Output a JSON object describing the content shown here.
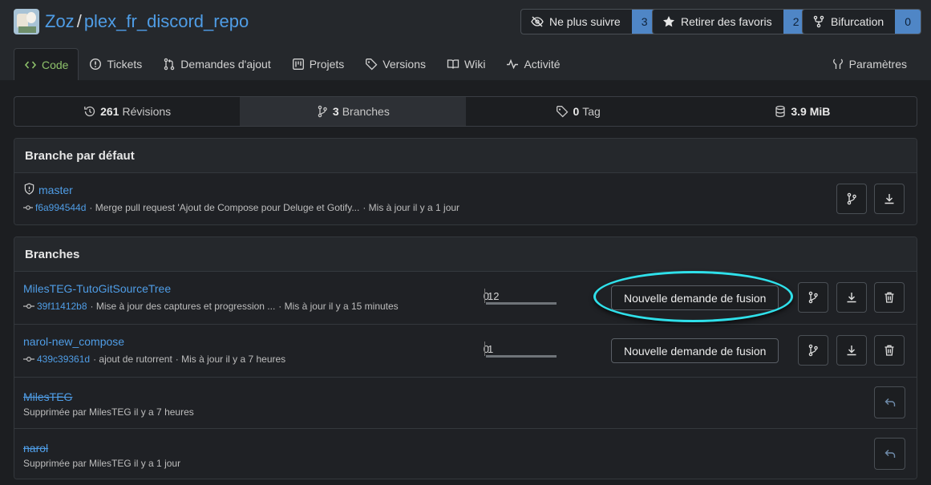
{
  "repo": {
    "owner": "Zoz",
    "separator": "/",
    "name": "plex_fr_discord_repo"
  },
  "header_buttons": {
    "watch": {
      "label": "Ne plus suivre",
      "count": "3"
    },
    "star": {
      "label": "Retirer des favoris",
      "count": "2"
    },
    "fork": {
      "label": "Bifurcation",
      "count": "0"
    }
  },
  "tabs": [
    {
      "label": "Code",
      "icon": "code-icon"
    },
    {
      "label": "Tickets",
      "icon": "issue-icon"
    },
    {
      "label": "Demandes d'ajout",
      "icon": "pull-request-icon"
    },
    {
      "label": "Projets",
      "icon": "project-icon"
    },
    {
      "label": "Versions",
      "icon": "tag-icon"
    },
    {
      "label": "Wiki",
      "icon": "book-icon"
    },
    {
      "label": "Activité",
      "icon": "pulse-icon"
    }
  ],
  "settings_tab": {
    "label": "Paramètres",
    "icon": "tools-icon"
  },
  "stats": {
    "commits": {
      "count": "261",
      "label": "Révisions"
    },
    "branches": {
      "count": "3",
      "label": "Branches"
    },
    "tags": {
      "count": "0",
      "label": "Tag"
    },
    "size": {
      "count": "3.9 MiB",
      "label": ""
    }
  },
  "default_branch": {
    "heading": "Branche par défaut",
    "name": "master",
    "sha": "f6a994544d",
    "message": "· Merge pull request 'Ajout de Compose pour Deluge et Gotify...",
    "updated": "· Mis à jour il y a 1 jour"
  },
  "branches": {
    "heading": "Branches",
    "pr_button_label": "Nouvelle demande de fusion",
    "active": [
      {
        "name": "MilesTEG-TutoGitSourceTree",
        "sha": "39f11412b8",
        "message": "· Mise à jour des captures et progression ...",
        "updated": "· Mis à jour il y a 15 minutes",
        "behind": "0",
        "ahead": "12"
      },
      {
        "name": "narol-new_compose",
        "sha": "439c39361d",
        "message": "· ajout de rutorrent",
        "updated": "· Mis à jour il y a 7 heures",
        "behind": "0",
        "ahead": "1"
      }
    ],
    "deleted": [
      {
        "name": "MilesTEG",
        "info": "Supprimée par MilesTEG il y a 7 heures"
      },
      {
        "name": "narol",
        "info": "Supprimée par MilesTEG il y a 1 jour"
      }
    ]
  },
  "colors": {
    "accent": "#4f9de6",
    "active_tab": "#8ec26b",
    "counter_bg": "#4f86c6",
    "highlight": "#2fe0ea"
  }
}
